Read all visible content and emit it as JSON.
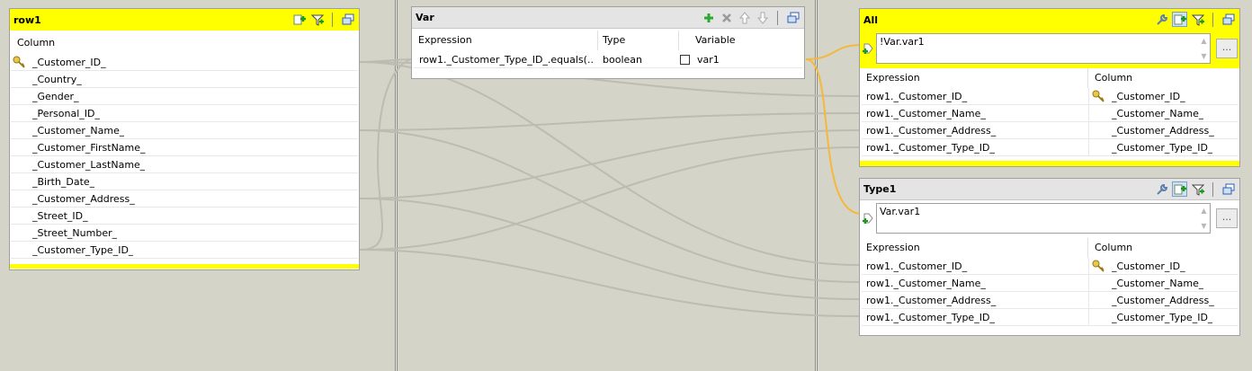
{
  "input_table": {
    "title": "row1",
    "column_header": "Column",
    "rows": [
      "_Customer_ID_",
      "_Country_",
      "_Gender_",
      "_Personal_ID_",
      "_Customer_Name_",
      "_Customer_FirstName_",
      "_Customer_LastName_",
      "_Birth_Date_",
      "_Customer_Address_",
      "_Street_ID_",
      "_Street_Number_",
      "_Customer_Type_ID_"
    ],
    "key_icon": "key-icon"
  },
  "var_table": {
    "title": "Var",
    "headers": {
      "expression": "Expression",
      "type": "Type",
      "variable": "Variable"
    },
    "rows": [
      {
        "expression": "row1._Customer_Type_ID_.equals(...",
        "type": "boolean",
        "variable": "var1",
        "nullable": false
      }
    ]
  },
  "outputs": [
    {
      "title": "All",
      "filter_expression": "!Var.var1",
      "dots_label": "...",
      "headers": {
        "expression": "Expression",
        "column": "Column"
      },
      "rows": [
        {
          "expression": "row1._Customer_ID_",
          "column": "_Customer_ID_",
          "key": true
        },
        {
          "expression": "row1._Customer_Name_",
          "column": "_Customer_Name_",
          "key": false
        },
        {
          "expression": "row1._Customer_Address_",
          "column": "_Customer_Address_",
          "key": false
        },
        {
          "expression": "row1._Customer_Type_ID_",
          "column": "_Customer_Type_ID_",
          "key": false
        }
      ]
    },
    {
      "title": "Type1",
      "filter_expression": "Var.var1",
      "dots_label": "...",
      "headers": {
        "expression": "Expression",
        "column": "Column"
      },
      "rows": [
        {
          "expression": "row1._Customer_ID_",
          "column": "_Customer_ID_",
          "key": true
        },
        {
          "expression": "row1._Customer_Name_",
          "column": "_Customer_Name_",
          "key": false
        },
        {
          "expression": "row1._Customer_Address_",
          "column": "_Customer_Address_",
          "key": false
        },
        {
          "expression": "row1._Customer_Type_ID_",
          "column": "_Customer_Type_ID_",
          "key": false
        }
      ]
    }
  ],
  "colors": {
    "header_yellow": "#ffff00",
    "link_gray": "#bcbcb2",
    "link_orange": "#f5b83d",
    "background": "#d4d4c8"
  },
  "icons": [
    "add-column-icon",
    "filter-icon",
    "minimize-icon",
    "remove-icon",
    "move-up-icon",
    "move-down-icon",
    "expression-filter-icon",
    "wrench-icon",
    "key-icon"
  ]
}
